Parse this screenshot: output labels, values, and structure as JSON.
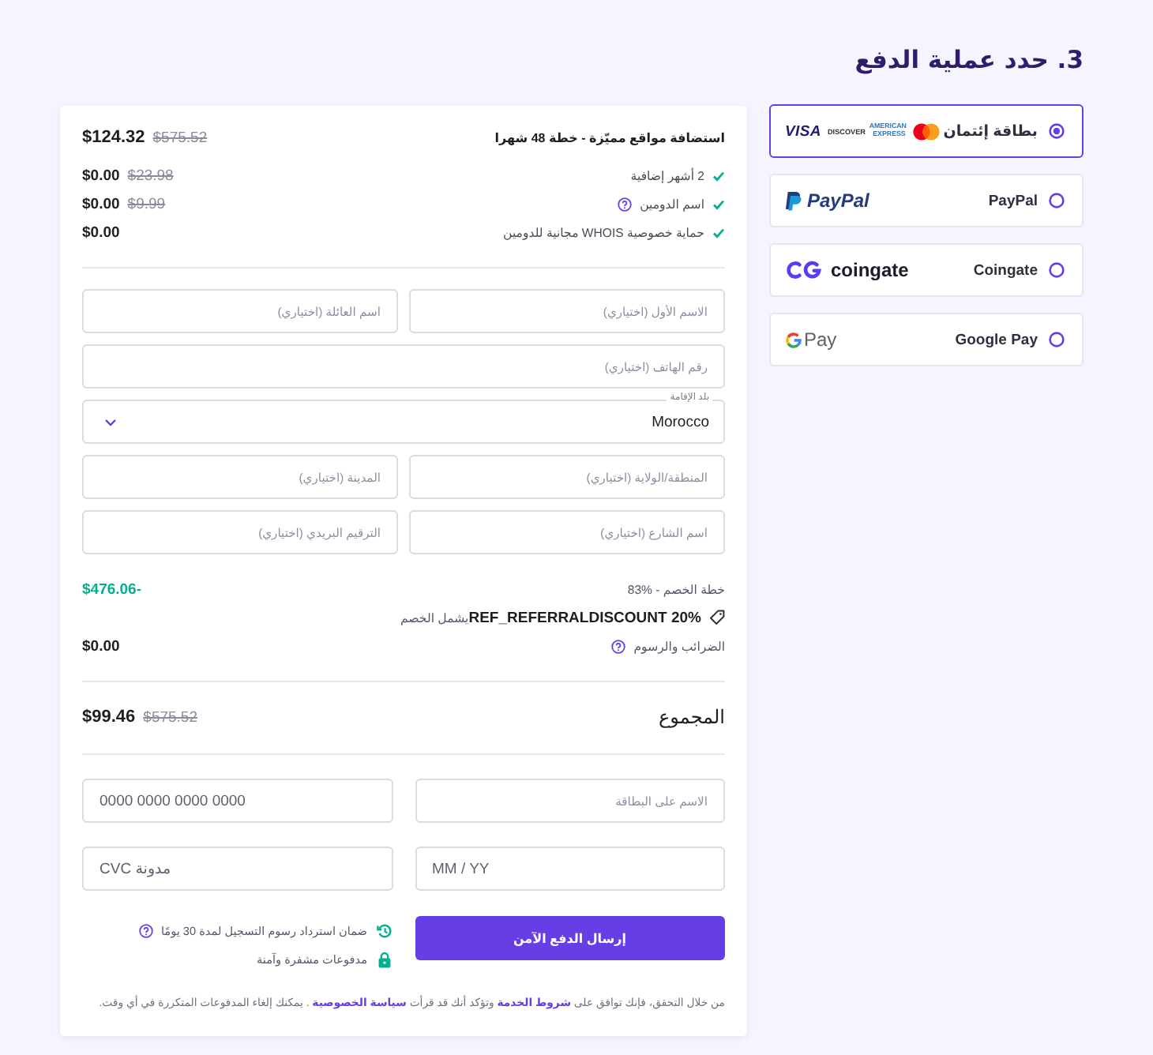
{
  "title": "3. حدد عملية الدفع",
  "payment_methods": [
    {
      "label": "بطاقة إئتمان",
      "selected": true,
      "logo": [
        {
          "kind": "mastercard"
        },
        {
          "kind": "amex",
          "text": "AMERICAN EXPRESS"
        },
        {
          "kind": "discover",
          "text": "DISCOVER"
        },
        {
          "kind": "visa",
          "text": "VISA"
        }
      ]
    },
    {
      "label": "PayPal",
      "selected": false,
      "logo": [
        {
          "kind": "paypal",
          "text": "PayPal"
        }
      ]
    },
    {
      "label": "Coingate",
      "selected": false,
      "logo": [
        {
          "kind": "coingate",
          "text": "coingate"
        }
      ]
    },
    {
      "label": "Google Pay",
      "selected": false,
      "logo": [
        {
          "kind": "gpay",
          "text": "Pay"
        }
      ]
    }
  ],
  "order": {
    "plan": {
      "name": "استضافة مواقع مميّزة - خطة 48 شهرا",
      "price": "$124.32",
      "old_price": "$575.52"
    },
    "items": [
      {
        "name": "2 أشهر إضافية",
        "help": false,
        "price": "$0.00",
        "old_price": "$23.98"
      },
      {
        "name": "اسم الدومين",
        "help": true,
        "price": "$0.00",
        "old_price": "$9.99"
      },
      {
        "name": "حماية خصوصية WHOIS مجانية للدومين",
        "help": false,
        "price": "$0.00"
      }
    ]
  },
  "billing": [
    {
      "fields": [
        {
          "kind": "text",
          "placeholder": "الاسم الأول (اختياري)"
        },
        {
          "kind": "text",
          "placeholder": "اسم العائلة (اختياري)"
        }
      ]
    },
    {
      "fields": [
        {
          "kind": "text",
          "placeholder": "رقم الهاتف (اختياري)"
        }
      ]
    },
    {
      "fields": [
        {
          "kind": "select",
          "label": "بلد الإقامة",
          "value": "Morocco"
        }
      ]
    },
    {
      "fields": [
        {
          "kind": "text",
          "placeholder": "المنطقة/الولاية (اختياري)"
        },
        {
          "kind": "text",
          "placeholder": "المدينة (اختياري)"
        }
      ]
    },
    {
      "fields": [
        {
          "kind": "text",
          "placeholder": "اسم الشارع (اختياري)"
        },
        {
          "kind": "text",
          "placeholder": "الترقيم البريدي (اختياري)"
        }
      ]
    }
  ],
  "discount": {
    "label": "خطة الخصم - %83",
    "amount": "-$476.06",
    "coupon": "**REF_REFERRALDISCOUNT 20%**يشمل الخصم"
  },
  "taxes": {
    "label": "الضرائب والرسوم",
    "help": true,
    "amount": "$0.00"
  },
  "total": {
    "label": "المجموع",
    "price": "$99.46",
    "old_price": "$575.52"
  },
  "card_fields": [
    {
      "placeholder": "الاسم على البطاقة"
    },
    {
      "placeholder": "0000 0000 0000 0000"
    },
    {
      "placeholder": "MM / YY"
    },
    {
      "placeholder": "CVC مدونة"
    }
  ],
  "submit_button": "إرسال الدفع الآمن",
  "guarantees": [
    {
      "kind": "refund",
      "text": "ضمان استرداد رسوم التسجيل لمدة 30 يومًا",
      "help": true
    },
    {
      "kind": "secure",
      "text": "مدفوعات مشفرة وآمنة",
      "help": false
    }
  ],
  "footer": [
    {
      "kind": "text",
      "text": "من خلال التحقق، فإنك توافق على "
    },
    {
      "kind": "link",
      "text": "شروط الخدمة"
    },
    {
      "kind": "text",
      "text": " وتؤكد أنك قد قرأت "
    },
    {
      "kind": "link",
      "text": "سياسة الخصوصية"
    },
    {
      "kind": "text",
      "text": " . يمكنك إلغاء المدفوعات المتكررة في أي وقت."
    }
  ]
}
